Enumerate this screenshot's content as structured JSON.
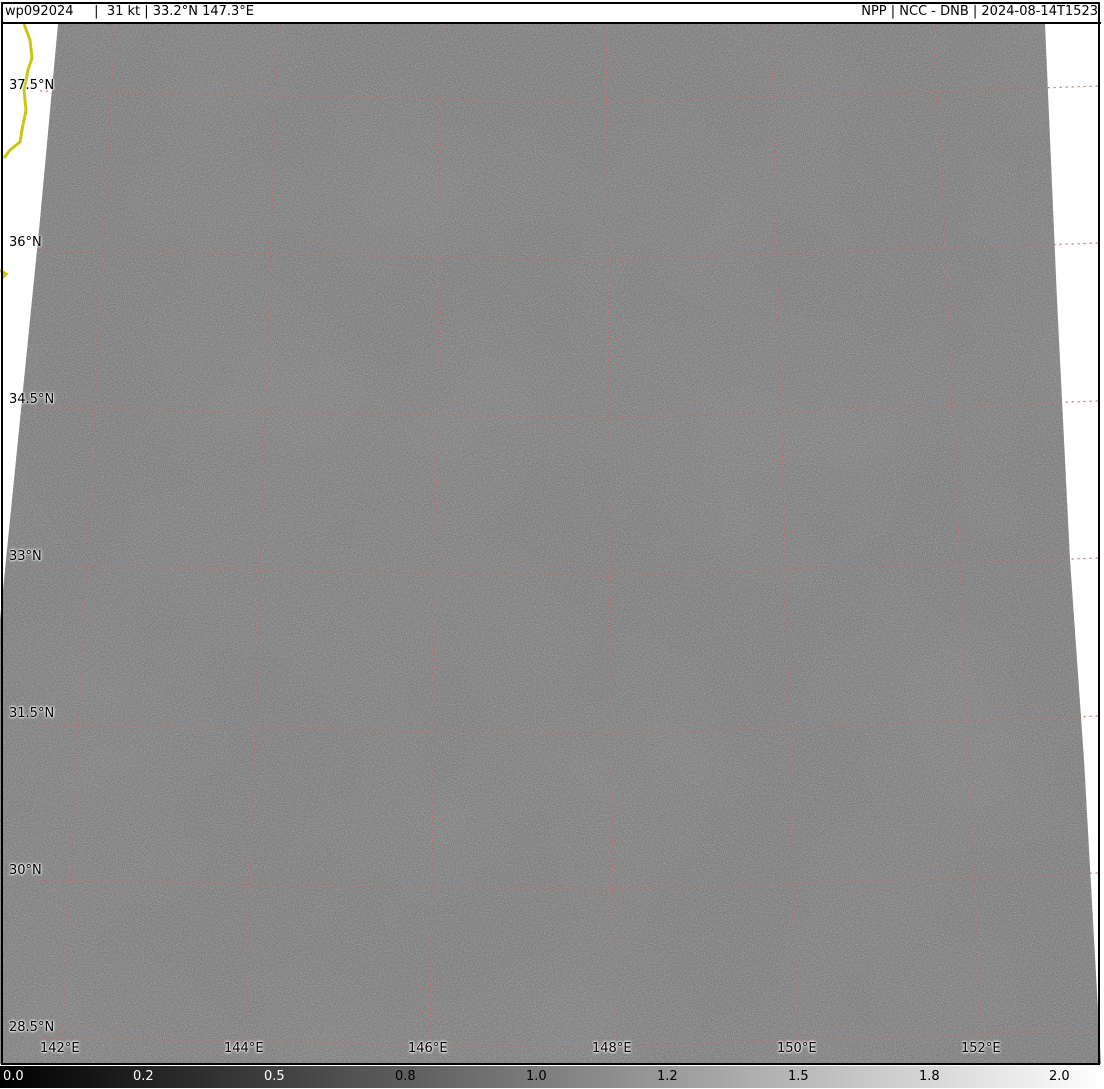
{
  "header": {
    "left_text": "wp092024     |  31 kt | 33.2°N 147.3°E",
    "right_text": "NPP | NCC - DNB | 2024-08-14T1523"
  },
  "map": {
    "lat_labels": [
      "37.5°N",
      "36°N",
      "34.5°N",
      "33°N",
      "31.5°N",
      "30°N",
      "28.5°N"
    ],
    "lon_labels": [
      "142°E",
      "144°E",
      "146°E",
      "148°E",
      "150°E",
      "152°E"
    ],
    "grid_color": "#c86e6e",
    "coastline_color": "#c8c814",
    "swath_color": "#7a7a7a"
  },
  "colorbar": {
    "ticks": [
      "0.0",
      "0.2",
      "0.5",
      "0.8",
      "1.0",
      "1.2",
      "1.5",
      "1.8",
      "2.0"
    ]
  }
}
